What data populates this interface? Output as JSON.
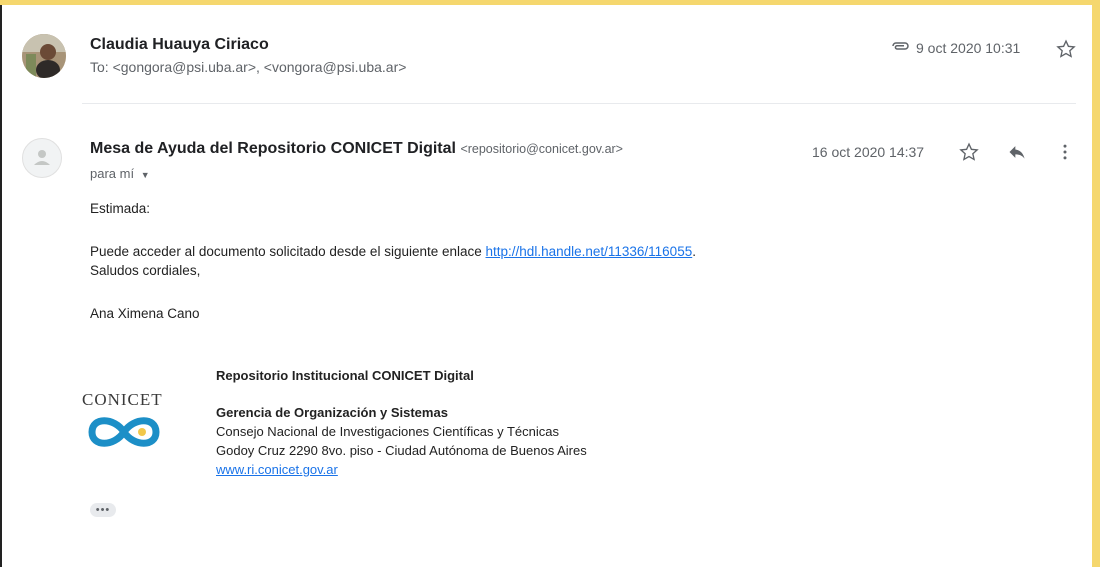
{
  "message1": {
    "sender": "Claudia Huauya Ciriaco",
    "to": "To: <gongora@psi.uba.ar>, <vongora@psi.uba.ar>",
    "date": "9 oct 2020 10:31",
    "icons": [
      "attachment-icon",
      "star-icon"
    ]
  },
  "message2": {
    "sender": "Mesa de Ayuda del Repositorio CONICET Digital",
    "sender_email": "<repositorio@conicet.gov.ar>",
    "recipient": "para mí",
    "date": "16 oct 2020 14:37",
    "icons": [
      "star-icon",
      "reply-icon",
      "more-vert-icon"
    ],
    "greeting": "Estimada:",
    "line1": "Puede acceder al documento solicitado desde el siguiente enlace",
    "link": "http://hdl.handle.net/11336/116055",
    "line1_end": ".",
    "line2": "Saludos cordiales,",
    "signer": "Ana Ximena Cano",
    "signature": {
      "title": "Repositorio Institucional CONICET Digital",
      "dept": "Gerencia de Organización y Sistemas",
      "org": "Consejo Nacional de Investigaciones Científicas y Técnicas",
      "address": "Godoy Cruz 2290 8vo. piso - Ciudad Autónoma de Buenos Aires",
      "website": "www.ri.conicet.gov.ar",
      "logo_text": "CONICET"
    },
    "expand": "•••"
  },
  "colors": {
    "background_frame": "#f5d76e",
    "link": "#1a73e8",
    "logo_blue": "#1c8fc7"
  }
}
